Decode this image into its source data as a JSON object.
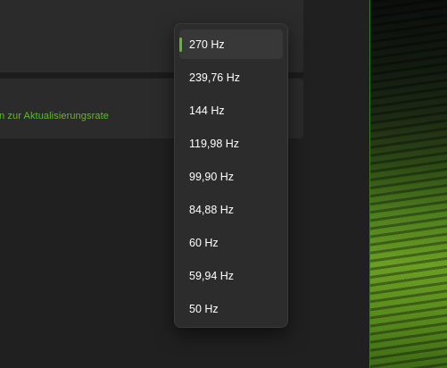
{
  "settings": {
    "link_text": "n zur Aktualisierungsrate"
  },
  "refresh_rate_dropdown": {
    "selected": "270 Hz",
    "options": [
      {
        "label": "270 Hz",
        "selected": true
      },
      {
        "label": "239,76 Hz",
        "selected": false
      },
      {
        "label": "144 Hz",
        "selected": false
      },
      {
        "label": "119,98 Hz",
        "selected": false
      },
      {
        "label": "99,90 Hz",
        "selected": false
      },
      {
        "label": "84,88 Hz",
        "selected": false
      },
      {
        "label": "60 Hz",
        "selected": false
      },
      {
        "label": "59,94 Hz",
        "selected": false
      },
      {
        "label": "50 Hz",
        "selected": false
      }
    ]
  },
  "colors": {
    "accent": "#5bbd2a",
    "menu_background": "#2c2c2c",
    "selected_background": "#383838",
    "window_background": "#202020",
    "card_background": "#2b2b2b"
  }
}
